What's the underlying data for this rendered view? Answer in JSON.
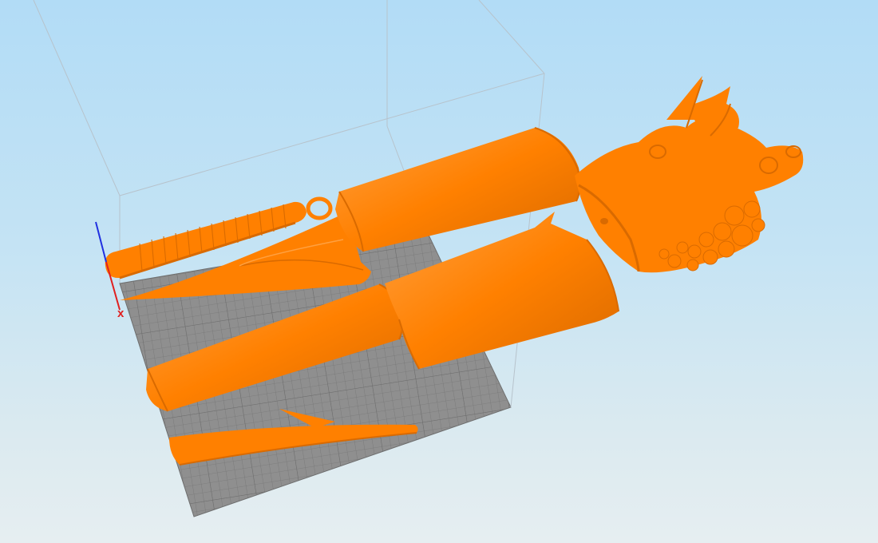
{
  "viewport": {
    "view": "3d-build-volume",
    "background_gradient": [
      "#b2dcf6",
      "#e6eef1"
    ]
  },
  "build_plate": {
    "color": "#8f8f8f",
    "grid_color": "#6e6e6e",
    "grid": true
  },
  "build_volume": {
    "edge_color": "#b7c3cc"
  },
  "model": {
    "color": "#ff8000",
    "shade_color": "#d96a00",
    "highlight_color": "#ffa040",
    "parts_count": 8
  },
  "axes": {
    "x": {
      "label": "x",
      "color": "#e02020"
    },
    "y": {
      "color": "#20b020"
    },
    "z": {
      "color": "#2030e0"
    }
  }
}
